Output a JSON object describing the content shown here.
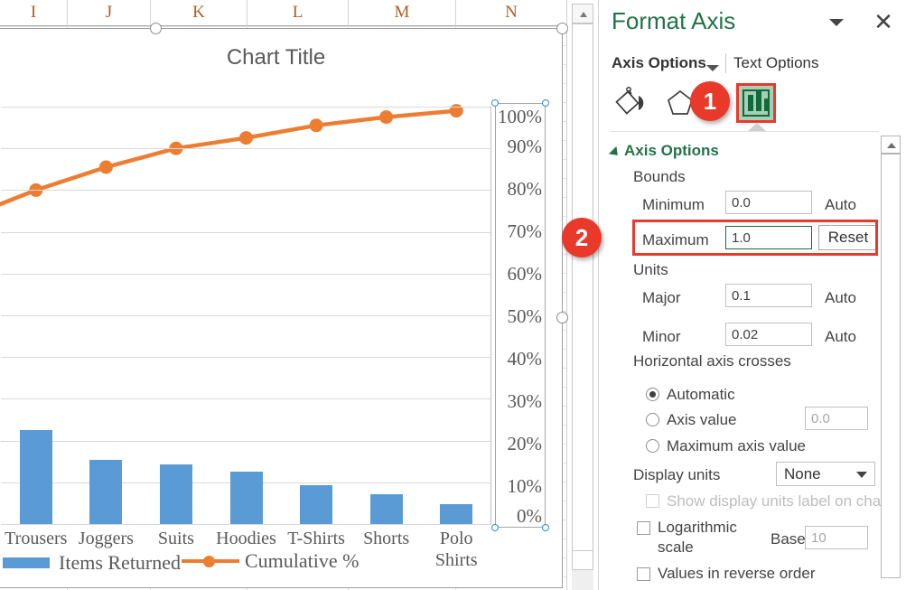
{
  "spreadsheet": {
    "column_headers": [
      "I",
      "J",
      "K",
      "L",
      "M",
      "N"
    ]
  },
  "chart": {
    "title": "Chart Title",
    "legend": [
      {
        "label": "Items Returned",
        "marker": "bar-swatch",
        "color": "#5b9bd5"
      },
      {
        "label": "Cumulative %",
        "marker": "line-marker",
        "color": "#ed7d31"
      }
    ]
  },
  "chart_data": {
    "type": "bar",
    "title": "Chart Title",
    "xlabel": "",
    "ylabel": "",
    "categories": [
      "Trousers",
      "Joggers",
      "Suits",
      "Hoodies",
      "T-Shirts",
      "Shorts",
      "Polo Shirts"
    ],
    "series": [
      {
        "name": "Items Returned",
        "type": "bar",
        "color": "#5b9bd5",
        "axis": "primary",
        "values": [
          104,
          71,
          66,
          58,
          43,
          33,
          22
        ]
      },
      {
        "name": "Cumulative %",
        "type": "line",
        "color": "#ed7d31",
        "axis": "secondary",
        "values": [
          0.8,
          0.855,
          0.9,
          0.925,
          0.955,
          0.975,
          0.99
        ]
      }
    ],
    "secondary_axis": {
      "tick_labels": [
        "0%",
        "10%",
        "20%",
        "30%",
        "40%",
        "50%",
        "60%",
        "70%",
        "80%",
        "90%",
        "100%"
      ],
      "min": 0.0,
      "max": 1.0,
      "major_unit": 0.1
    },
    "grid": true,
    "legend_position": "bottom"
  },
  "pane": {
    "title": "Format Axis",
    "close_label": "✕",
    "tabs": {
      "axis_options": "Axis Options",
      "text_options": "Text Options"
    },
    "icons": [
      {
        "name": "fill-icon",
        "label": "Fill & Line"
      },
      {
        "name": "effects-icon",
        "label": "Effects"
      },
      {
        "name": "axis-options-icon",
        "label": "Axis Options",
        "selected": true
      }
    ],
    "section_title": "Axis Options",
    "bounds": {
      "group_label": "Bounds",
      "minimum": {
        "label": "Minimum",
        "value": "0.0",
        "action": "Auto"
      },
      "maximum": {
        "label": "Maximum",
        "value": "1.0",
        "action": "Reset"
      }
    },
    "units": {
      "group_label": "Units",
      "major": {
        "label": "Major",
        "value": "0.1",
        "action": "Auto"
      },
      "minor": {
        "label": "Minor",
        "value": "0.02",
        "action": "Auto"
      }
    },
    "horizontal_axis_crosses": {
      "group_label": "Horizontal axis crosses",
      "options": [
        {
          "label": "Automatic",
          "selected": true
        },
        {
          "label": "Axis value",
          "selected": false,
          "value": "0.0"
        },
        {
          "label": "Maximum axis value",
          "selected": false
        }
      ]
    },
    "display_units": {
      "label": "Display units",
      "value": "None",
      "show_label_checkbox": "Show display units label on chart",
      "show_label_checked": false
    },
    "logarithmic": {
      "label_line1": "Logarithmic",
      "label_line2": "scale",
      "checked": false,
      "base_label": "Base",
      "base_value": "10"
    },
    "reverse_order": {
      "label": "Values in reverse order",
      "checked": false
    }
  },
  "callouts": [
    {
      "number": "1",
      "target": "axis-options-icon"
    },
    {
      "number": "2",
      "target": "maximum-field"
    }
  ],
  "colors": {
    "accent_green": "#217346",
    "callout_red": "#e8392b",
    "bar_blue": "#5b9bd5",
    "line_orange": "#ed7d31"
  }
}
